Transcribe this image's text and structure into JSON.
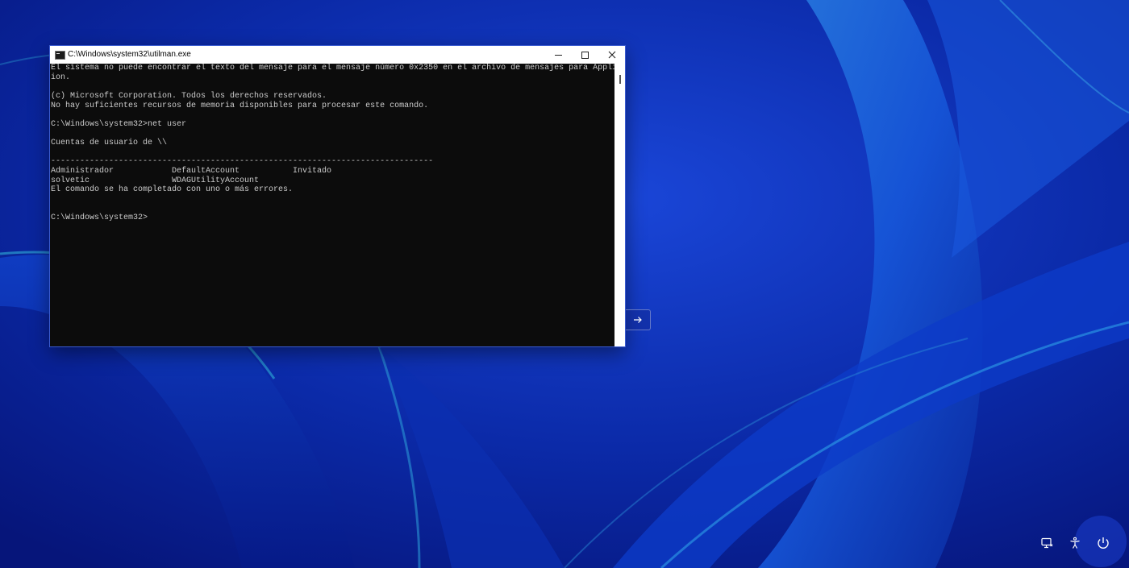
{
  "window": {
    "title": "C:\\Windows\\system32\\utilman.exe"
  },
  "console": {
    "lines": [
      "El sistema no puede encontrar el texto del mensaje para el mensaje número 0x2350 en el archivo de mensajes para Applicat",
      "ion.",
      "",
      "(c) Microsoft Corporation. Todos los derechos reservados.",
      "No hay suficientes recursos de memoria disponibles para procesar este comando.",
      "",
      "C:\\Windows\\system32>net user",
      "",
      "Cuentas de usuario de \\\\",
      "",
      "-------------------------------------------------------------------------------",
      "Administrador            DefaultAccount           Invitado",
      "solvetic                 WDAGUtilityAccount",
      "El comando se ha completado con uno o más errores.",
      "",
      "",
      "C:\\Windows\\system32>"
    ]
  },
  "icons": {
    "app": "console-app-icon",
    "minimize": "minimize-icon",
    "maximize": "maximize-icon",
    "close": "close-icon",
    "arrow": "arrow-right-icon",
    "network": "network-icon",
    "accessibility": "accessibility-icon",
    "power": "power-icon"
  },
  "colors": {
    "console_bg": "#0c0c0c",
    "console_text": "#cccccc",
    "desktop_bg": "#0a1f8f",
    "titlebar_bg": "#ffffff"
  }
}
